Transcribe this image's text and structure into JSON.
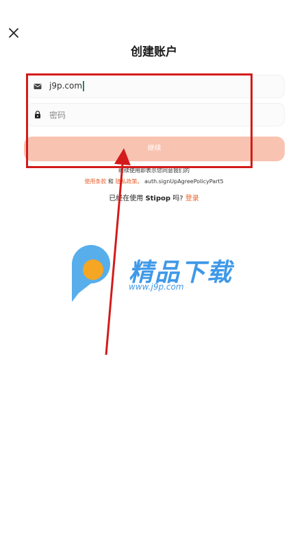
{
  "header": {
    "title": "创建账户"
  },
  "form": {
    "email_value": "j9p.com",
    "password_placeholder": "密码",
    "continue_label": "继续"
  },
  "agreement": {
    "line1": "继续使用即表示您同意我们的",
    "terms_link": "使用条款",
    "and": "和",
    "privacy_link": "隐私政策。",
    "suffix": "auth.signUpAgreePolicyPart5"
  },
  "login": {
    "prefix": "已经在使用",
    "brand": "Stipop",
    "question": "吗?",
    "link": "登录"
  },
  "watermark": {
    "title": "精品下载",
    "url": "www.j9p.com"
  },
  "colors": {
    "accent": "#e8612f",
    "button": "#f9c3b1",
    "annotation": "#d41a1a"
  }
}
